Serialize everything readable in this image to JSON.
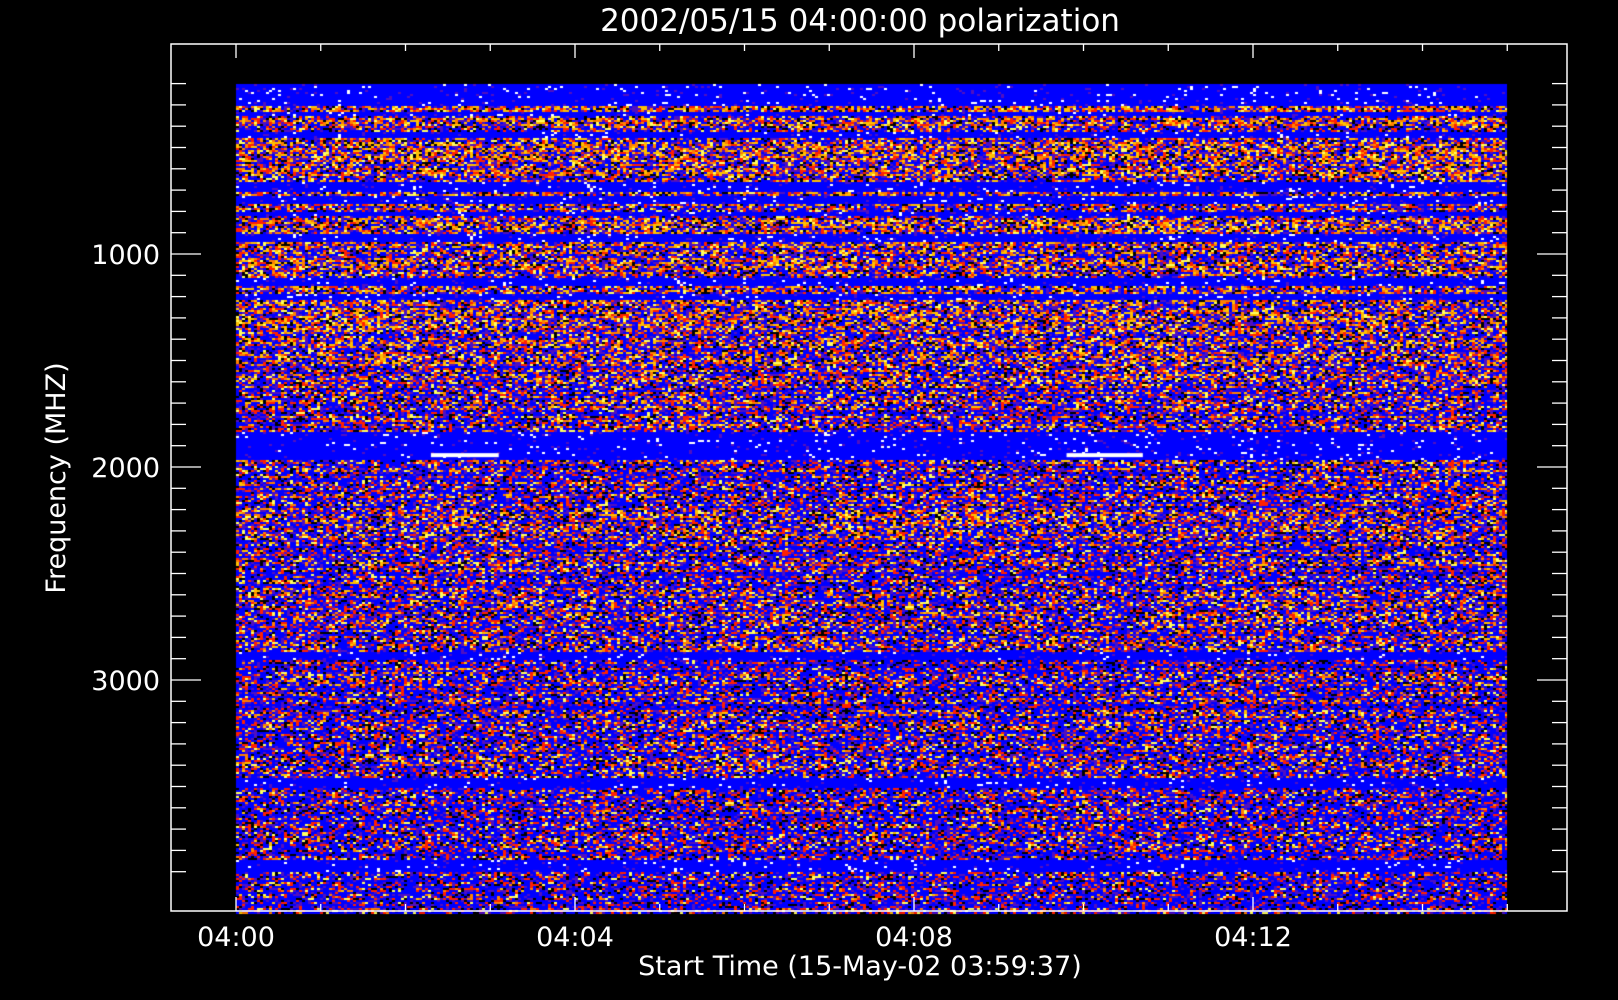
{
  "chart_data": {
    "type": "heatmap",
    "title": "2002/05/15 04:00:00 polarization",
    "xlabel": "Start Time (15-May-02 03:59:37)",
    "ylabel": "Frequency (MHZ)",
    "x_ticks": [
      "04:00",
      "04:04",
      "04:08",
      "04:12"
    ],
    "x_tick_values_minutes": [
      0,
      4,
      8,
      12
    ],
    "xlim_minutes": [
      0,
      15
    ],
    "y_ticks": [
      1000,
      2000,
      3000
    ],
    "ylim": [
      100,
      4200
    ],
    "y_inverted": true,
    "data_xlim_minutes": [
      0,
      15
    ],
    "data_ylim": [
      200,
      4100
    ],
    "colormap": [
      "#000000",
      "#0000ff",
      "#5010c0",
      "#ff2000",
      "#ff8000",
      "#ffc000",
      "#ffff60",
      "#ffffff"
    ],
    "background_color": "#000000",
    "axis_color": "#ffffff",
    "saturated_bands_mhz": [
      [
        200,
        300
      ],
      [
        330,
        345
      ],
      [
        420,
        450
      ],
      [
        660,
        700
      ],
      [
        720,
        760
      ],
      [
        800,
        820
      ],
      [
        900,
        940
      ],
      [
        1110,
        1150
      ],
      [
        1180,
        1210
      ],
      [
        1830,
        1960
      ],
      [
        2860,
        2900
      ],
      [
        3460,
        3500
      ],
      [
        3840,
        3900
      ]
    ]
  }
}
